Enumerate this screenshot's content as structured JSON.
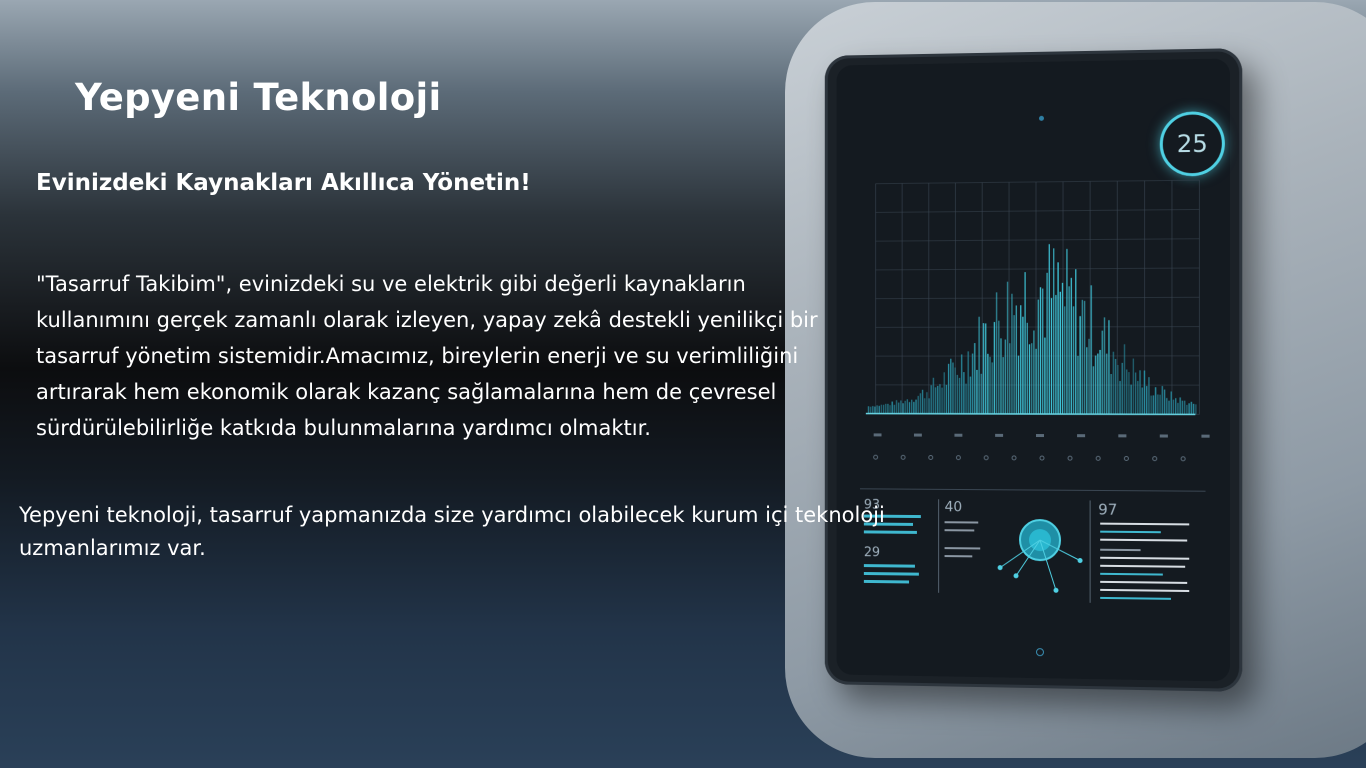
{
  "slide": {
    "title": "Yepyeni Teknoloji",
    "subtitle": "Evinizdeki Kaynakları Akıllıca Yönetin!",
    "paragraph": "\"Tasarruf Takibim\", evinizdeki su ve elektrik gibi değerli kaynakların kullanımını gerçek zamanlı olarak izleyen, yapay zekâ destekli yenilikçi bir tasarruf yönetim sistemidir.Amacımız, bireylerin enerji ve su verimliliğini artırarak hem ekonomik olarak kazanç sağlamalarına hem de çevresel sürdürülebilirliğe katkıda bulunmalarına yardımcı olmaktır.",
    "note": "Yepyeni teknoloji, tasarruf  yapmanızda size yardımcı olabilecek kurum içi teknoloji uzmanlarımız var."
  },
  "tablet": {
    "badge_value": "25",
    "accent_color": "#4fd0e3",
    "panel_values": [
      "93",
      "29",
      "40",
      "97"
    ]
  }
}
